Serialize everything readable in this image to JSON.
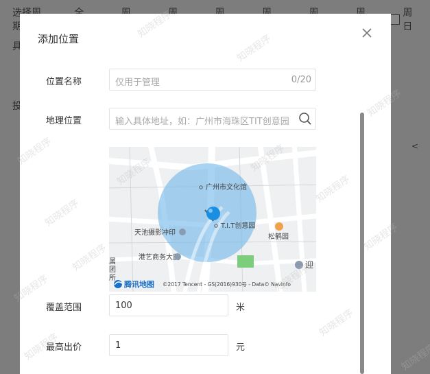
{
  "background": {
    "row_label": "选择周期",
    "days": [
      "全部",
      "周一",
      "周二",
      "周三",
      "周四",
      "周五",
      "周六",
      "周日"
    ],
    "side_label_1": "具",
    "side_label_2": "投",
    "side_arrow": "<"
  },
  "modal": {
    "title": "添加位置",
    "name_field": {
      "label": "位置名称",
      "placeholder": "仅用于管理",
      "counter": "0/20"
    },
    "location_field": {
      "label": "地理位置",
      "placeholder": "输入具体地址，如：广州市海珠区TIT创意园"
    },
    "map": {
      "labels": {
        "museum": "广州市文化馆",
        "park": "T.I.T创意园",
        "photo": "天池摄影冲印",
        "songhe": "松鹤园",
        "gangyi": "港艺商务大厦",
        "tuan1": "属",
        "tuan2": "团",
        "tuan3": "所",
        "ying": "迎"
      },
      "logo": "腾讯地图",
      "copyright": "©2017 Tencent - GS(2016)930号 - Data© NavInfo",
      "colors": {
        "circle": "#6fb6ea",
        "marker": "#1a8fe0"
      }
    },
    "coverage_field": {
      "label": "覆盖范围",
      "value": "100",
      "unit": "米"
    },
    "bid_field": {
      "label": "最高出价",
      "value": "1",
      "unit": "元"
    }
  },
  "watermark": "知晓程序",
  "colors": {
    "overlay": "#7d7d7d",
    "modal_bg": "#ffffff"
  }
}
